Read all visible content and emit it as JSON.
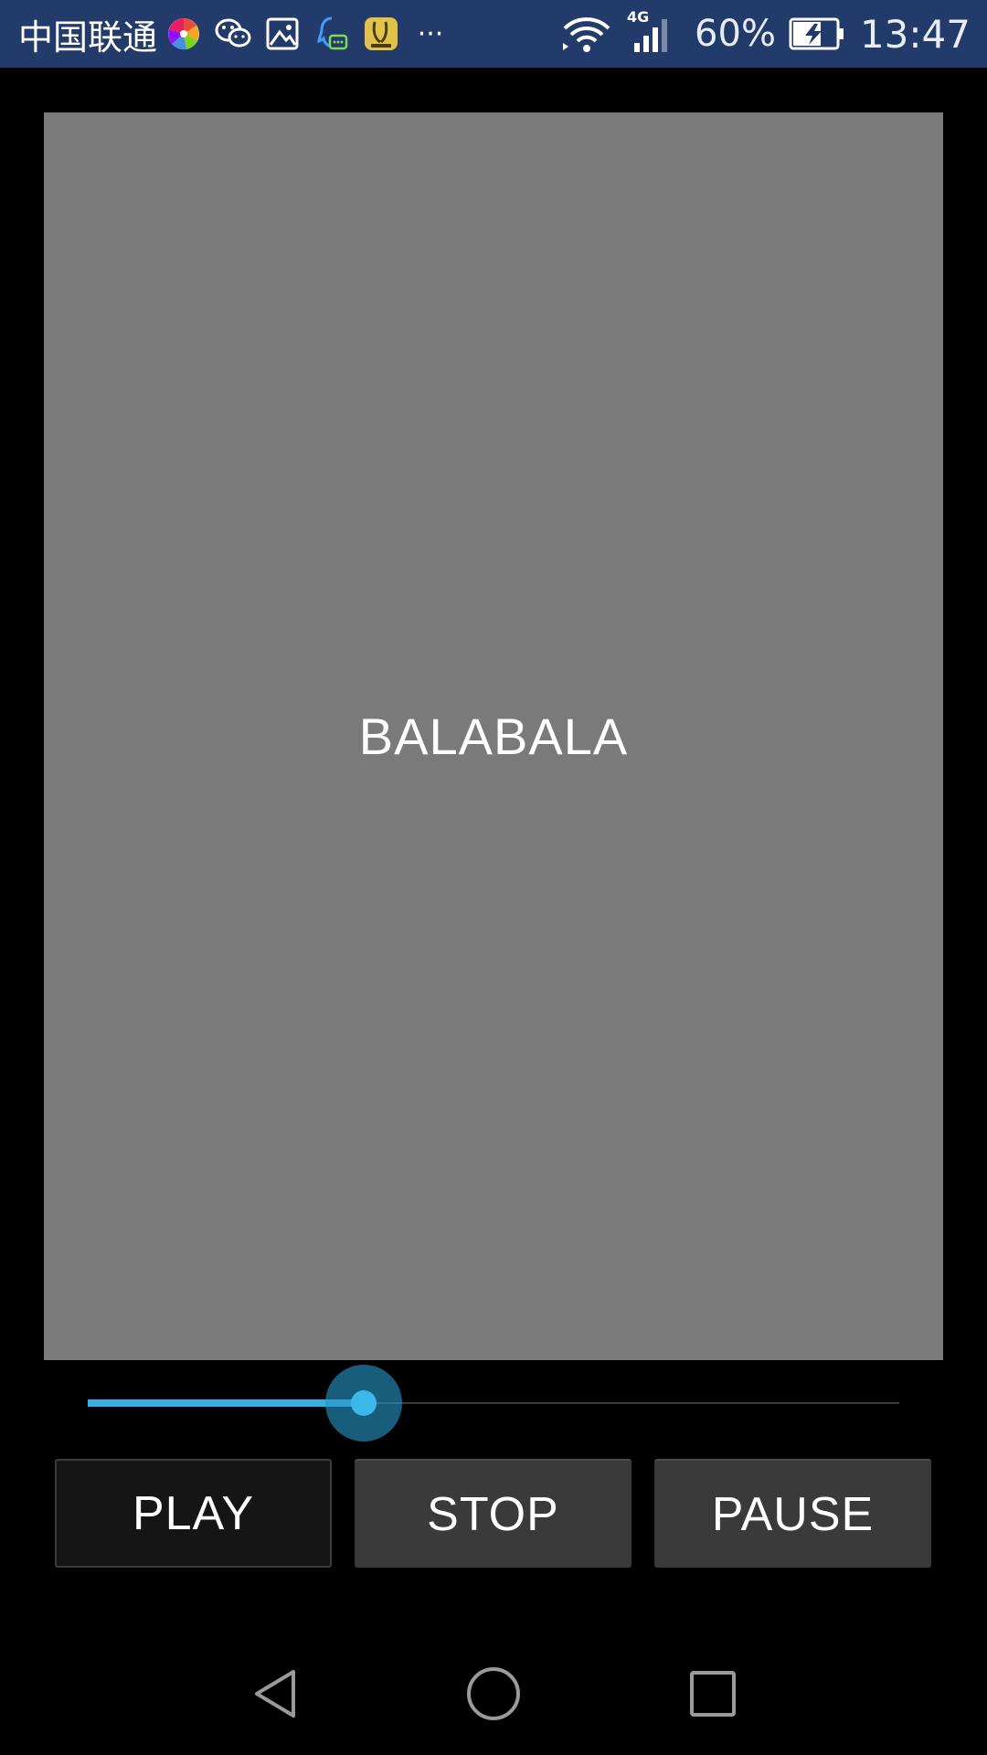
{
  "status_bar": {
    "carrier": "中国联通",
    "notification_icons": [
      "app-pinwheel-icon",
      "wechat-icon",
      "image-icon",
      "qq-icon",
      "banana-touch-icon",
      "more-dots-icon"
    ],
    "more_label": "···",
    "network_type": "4G",
    "battery_percent": "60%",
    "time": "13:47"
  },
  "video": {
    "overlay_text": "BALABALA"
  },
  "seekbar": {
    "progress": 0.34
  },
  "controls": {
    "play_label": "PLAY",
    "stop_label": "STOP",
    "pause_label": "PAUSE"
  },
  "nav": {
    "back": "back-icon",
    "home": "home-icon",
    "recents": "recents-icon"
  },
  "colors": {
    "status_bar": "#233b6b",
    "accent": "#35b0e0",
    "video_bg": "#7a7a7a",
    "button_bg": "#3a3a3a"
  }
}
